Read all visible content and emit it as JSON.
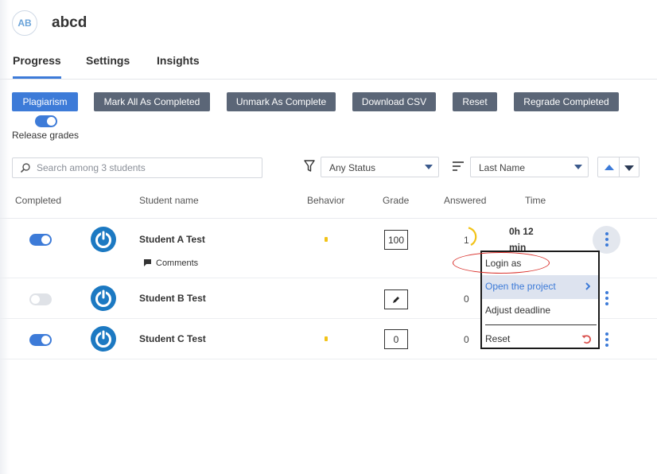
{
  "header": {
    "avatar_initials": "AB",
    "title": "abcd"
  },
  "tabs": [
    {
      "label": "Progress",
      "active": true
    },
    {
      "label": "Settings",
      "active": false
    },
    {
      "label": "Insights",
      "active": false
    }
  ],
  "toolbar": {
    "plagiarism": "Plagiarism",
    "mark_all": "Mark All As Completed",
    "unmark_all": "Unmark As Complete",
    "download_csv": "Download CSV",
    "reset": "Reset",
    "regrade": "Regrade Completed",
    "release_grades_label": "Release grades",
    "release_grades_on": true
  },
  "filters": {
    "search_placeholder": "Search among 3 students",
    "status_value": "Any Status",
    "sort_value": "Last Name"
  },
  "table": {
    "columns": {
      "completed": "Completed",
      "student_name": "Student name",
      "behavior": "Behavior",
      "grade": "Grade",
      "answered": "Answered",
      "time": "Time"
    },
    "rows": [
      {
        "completed": true,
        "name": "Student A Test",
        "behavior": true,
        "grade": "100",
        "answered": "1",
        "time_line1": "0h 12",
        "time_line2": "min",
        "comments": "Comments"
      },
      {
        "completed": false,
        "name": "Student B Test",
        "behavior": false,
        "grade": "",
        "grade_icon": "pencil-icon",
        "answered": "0"
      },
      {
        "completed": true,
        "name": "Student C Test",
        "behavior": true,
        "grade": "0",
        "answered": "0"
      }
    ]
  },
  "context_menu": {
    "items": [
      {
        "label": "Login as"
      },
      {
        "label": "Open the project",
        "highlighted": true
      },
      {
        "label": "Adjust deadline"
      },
      {
        "label": "Reset"
      }
    ]
  },
  "colors": {
    "accent": "#3d7bd8",
    "button_gray": "#5b6677",
    "behavior": "#f2c318",
    "annotation": "#d9302b"
  }
}
